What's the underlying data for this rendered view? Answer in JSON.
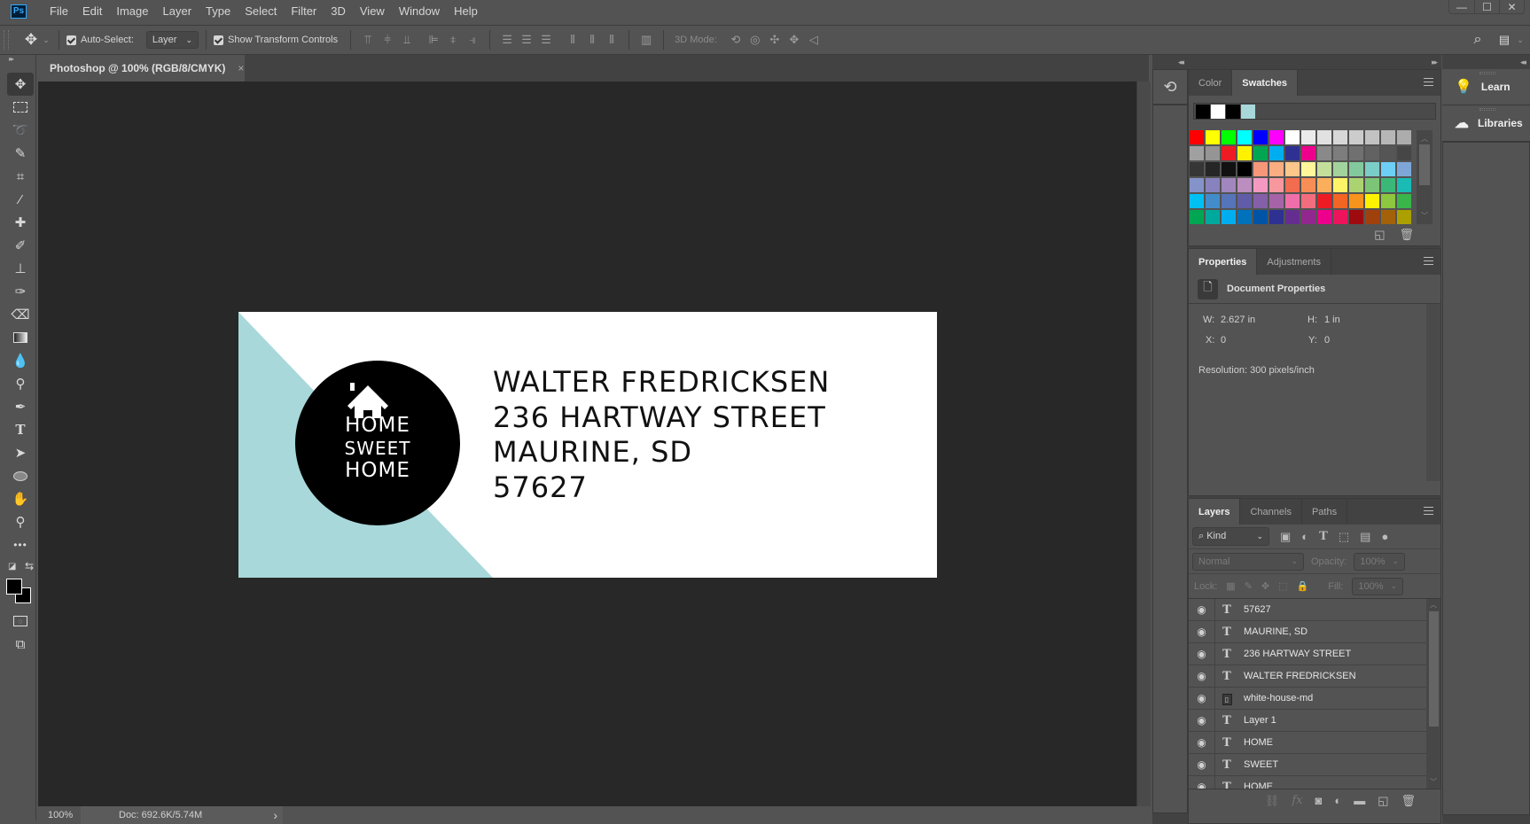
{
  "app": {
    "logo": "Ps"
  },
  "menu": [
    "File",
    "Edit",
    "Image",
    "Layer",
    "Type",
    "Select",
    "Filter",
    "3D",
    "View",
    "Window",
    "Help"
  ],
  "window_controls": {
    "minimize": "—",
    "maximize": "☐",
    "close": "✕"
  },
  "options_bar": {
    "auto_select_label": "Auto-Select:",
    "auto_select_checked": true,
    "auto_select_target": "Layer",
    "show_transform_label": "Show Transform Controls",
    "show_transform_checked": true,
    "mode_3d_label": "3D Mode:"
  },
  "document": {
    "tab_title": "Photoshop  @ 100% (RGB/8/CMYK)",
    "tab_close": "×",
    "zoom": "100%",
    "doc_info": "Doc: 692.6K/5.74M",
    "status_arrow": "›"
  },
  "artwork": {
    "accent_color": "#a8d8da",
    "badge_lines": [
      "HOME",
      "SWEET",
      "HOME"
    ],
    "address_lines": [
      "WALTER FREDRICKSEN",
      "236 HARTWAY STREET",
      "MAURINE, SD",
      "57627"
    ]
  },
  "swatches_panel": {
    "tabs": [
      "Color",
      "Swatches"
    ],
    "active_tab": "Swatches",
    "recent": [
      "#000000",
      "#ffffff",
      "#000000",
      "#a8d8da"
    ],
    "grid": [
      [
        "#ff0000",
        "#ffff00",
        "#00ff00",
        "#00ffff",
        "#0000ff",
        "#ff00ff",
        "#ffffff",
        "#ebebeb",
        "#e1e1e1",
        "#d7d7d7",
        "#cccccc",
        "#c2c2c2",
        "#b7b7b7",
        "#acacac"
      ],
      [
        "#a0a0a0",
        "#959595",
        "#ed1c24",
        "#fff200",
        "#00a651",
        "#00aeef",
        "#2e3192",
        "#ec008c",
        "#898989",
        "#7d7d7d",
        "#707070",
        "#626262",
        "#555555",
        "#464646"
      ],
      [
        "#363636",
        "#262626",
        "#111111",
        "#000000",
        "#f7977a",
        "#f9ad81",
        "#fdc68a",
        "#fff79a",
        "#c4df9b",
        "#a3d39c",
        "#82ca9d",
        "#7bcdc8",
        "#6ecff6",
        "#7ea7d8"
      ],
      [
        "#8493ca",
        "#8882be",
        "#a187be",
        "#bc8dbf",
        "#f49ac2",
        "#f6989d",
        "#f26c4f",
        "#f68e55",
        "#fbaf5c",
        "#fff467",
        "#acd372",
        "#7cc576",
        "#3bb878",
        "#1abbb4"
      ],
      [
        "#00bff3",
        "#438ccb",
        "#5574b9",
        "#605ca8",
        "#855fa8",
        "#a763a8",
        "#f06ea9",
        "#f26d7d",
        "#ed1c24",
        "#f26522",
        "#f7941d",
        "#fff200",
        "#8dc63f",
        "#39b54a"
      ],
      [
        "#00a651",
        "#00a99d",
        "#00aeef",
        "#0072bc",
        "#0054a6",
        "#2e3192",
        "#662d91",
        "#92278f",
        "#ec008c",
        "#ed145b",
        "#9e0b0f",
        "#a0410d",
        "#a36209",
        "#aba000"
      ]
    ]
  },
  "properties_panel": {
    "tabs": [
      "Properties",
      "Adjustments"
    ],
    "active_tab": "Properties",
    "section_title": "Document Properties",
    "w_label": "W:",
    "w_value": "2.627 in",
    "h_label": "H:",
    "h_value": "1 in",
    "x_label": "X:",
    "x_value": "0",
    "y_label": "Y:",
    "y_value": "0",
    "resolution": "Resolution: 300 pixels/inch"
  },
  "layers_panel": {
    "tabs": [
      "Layers",
      "Channels",
      "Paths"
    ],
    "active_tab": "Layers",
    "filter_kind": "Kind",
    "blend_mode": "Normal",
    "opacity_label": "Opacity:",
    "opacity_value": "100%",
    "lock_label": "Lock:",
    "fill_label": "Fill:",
    "fill_value": "100%",
    "layers": [
      {
        "name": "57627",
        "type": "text",
        "visible": true
      },
      {
        "name": "MAURINE, SD",
        "type": "text",
        "visible": true
      },
      {
        "name": "236 HARTWAY STREET",
        "type": "text",
        "visible": true
      },
      {
        "name": "WALTER FREDRICKSEN",
        "type": "text",
        "visible": true
      },
      {
        "name": "white-house-md",
        "type": "smart-object",
        "visible": true
      },
      {
        "name": "Layer 1",
        "type": "text",
        "visible": true
      },
      {
        "name": "HOME",
        "type": "text",
        "visible": true
      },
      {
        "name": "SWEET",
        "type": "text",
        "visible": true
      },
      {
        "name": "HOME",
        "type": "text",
        "visible": true
      }
    ]
  },
  "side_panels": [
    {
      "label": "Learn",
      "icon": "lightbulb-icon"
    },
    {
      "label": "Libraries",
      "icon": "creative-cloud-icon"
    }
  ]
}
